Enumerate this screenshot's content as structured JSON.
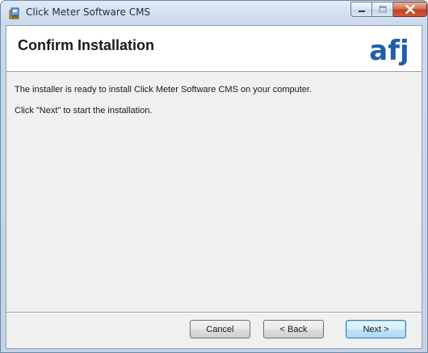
{
  "window": {
    "title": "Click Meter Software CMS"
  },
  "banner": {
    "title": "Confirm Installation",
    "logo_text": "afj"
  },
  "body": {
    "line1": "The installer is ready to install Click Meter Software CMS on your computer.",
    "line2": "Click \"Next\" to start the installation."
  },
  "buttons": {
    "cancel": "Cancel",
    "back": "< Back",
    "next": "Next >"
  },
  "colors": {
    "logo_blue": "#1f5fa8",
    "close_red": "#c24123"
  }
}
